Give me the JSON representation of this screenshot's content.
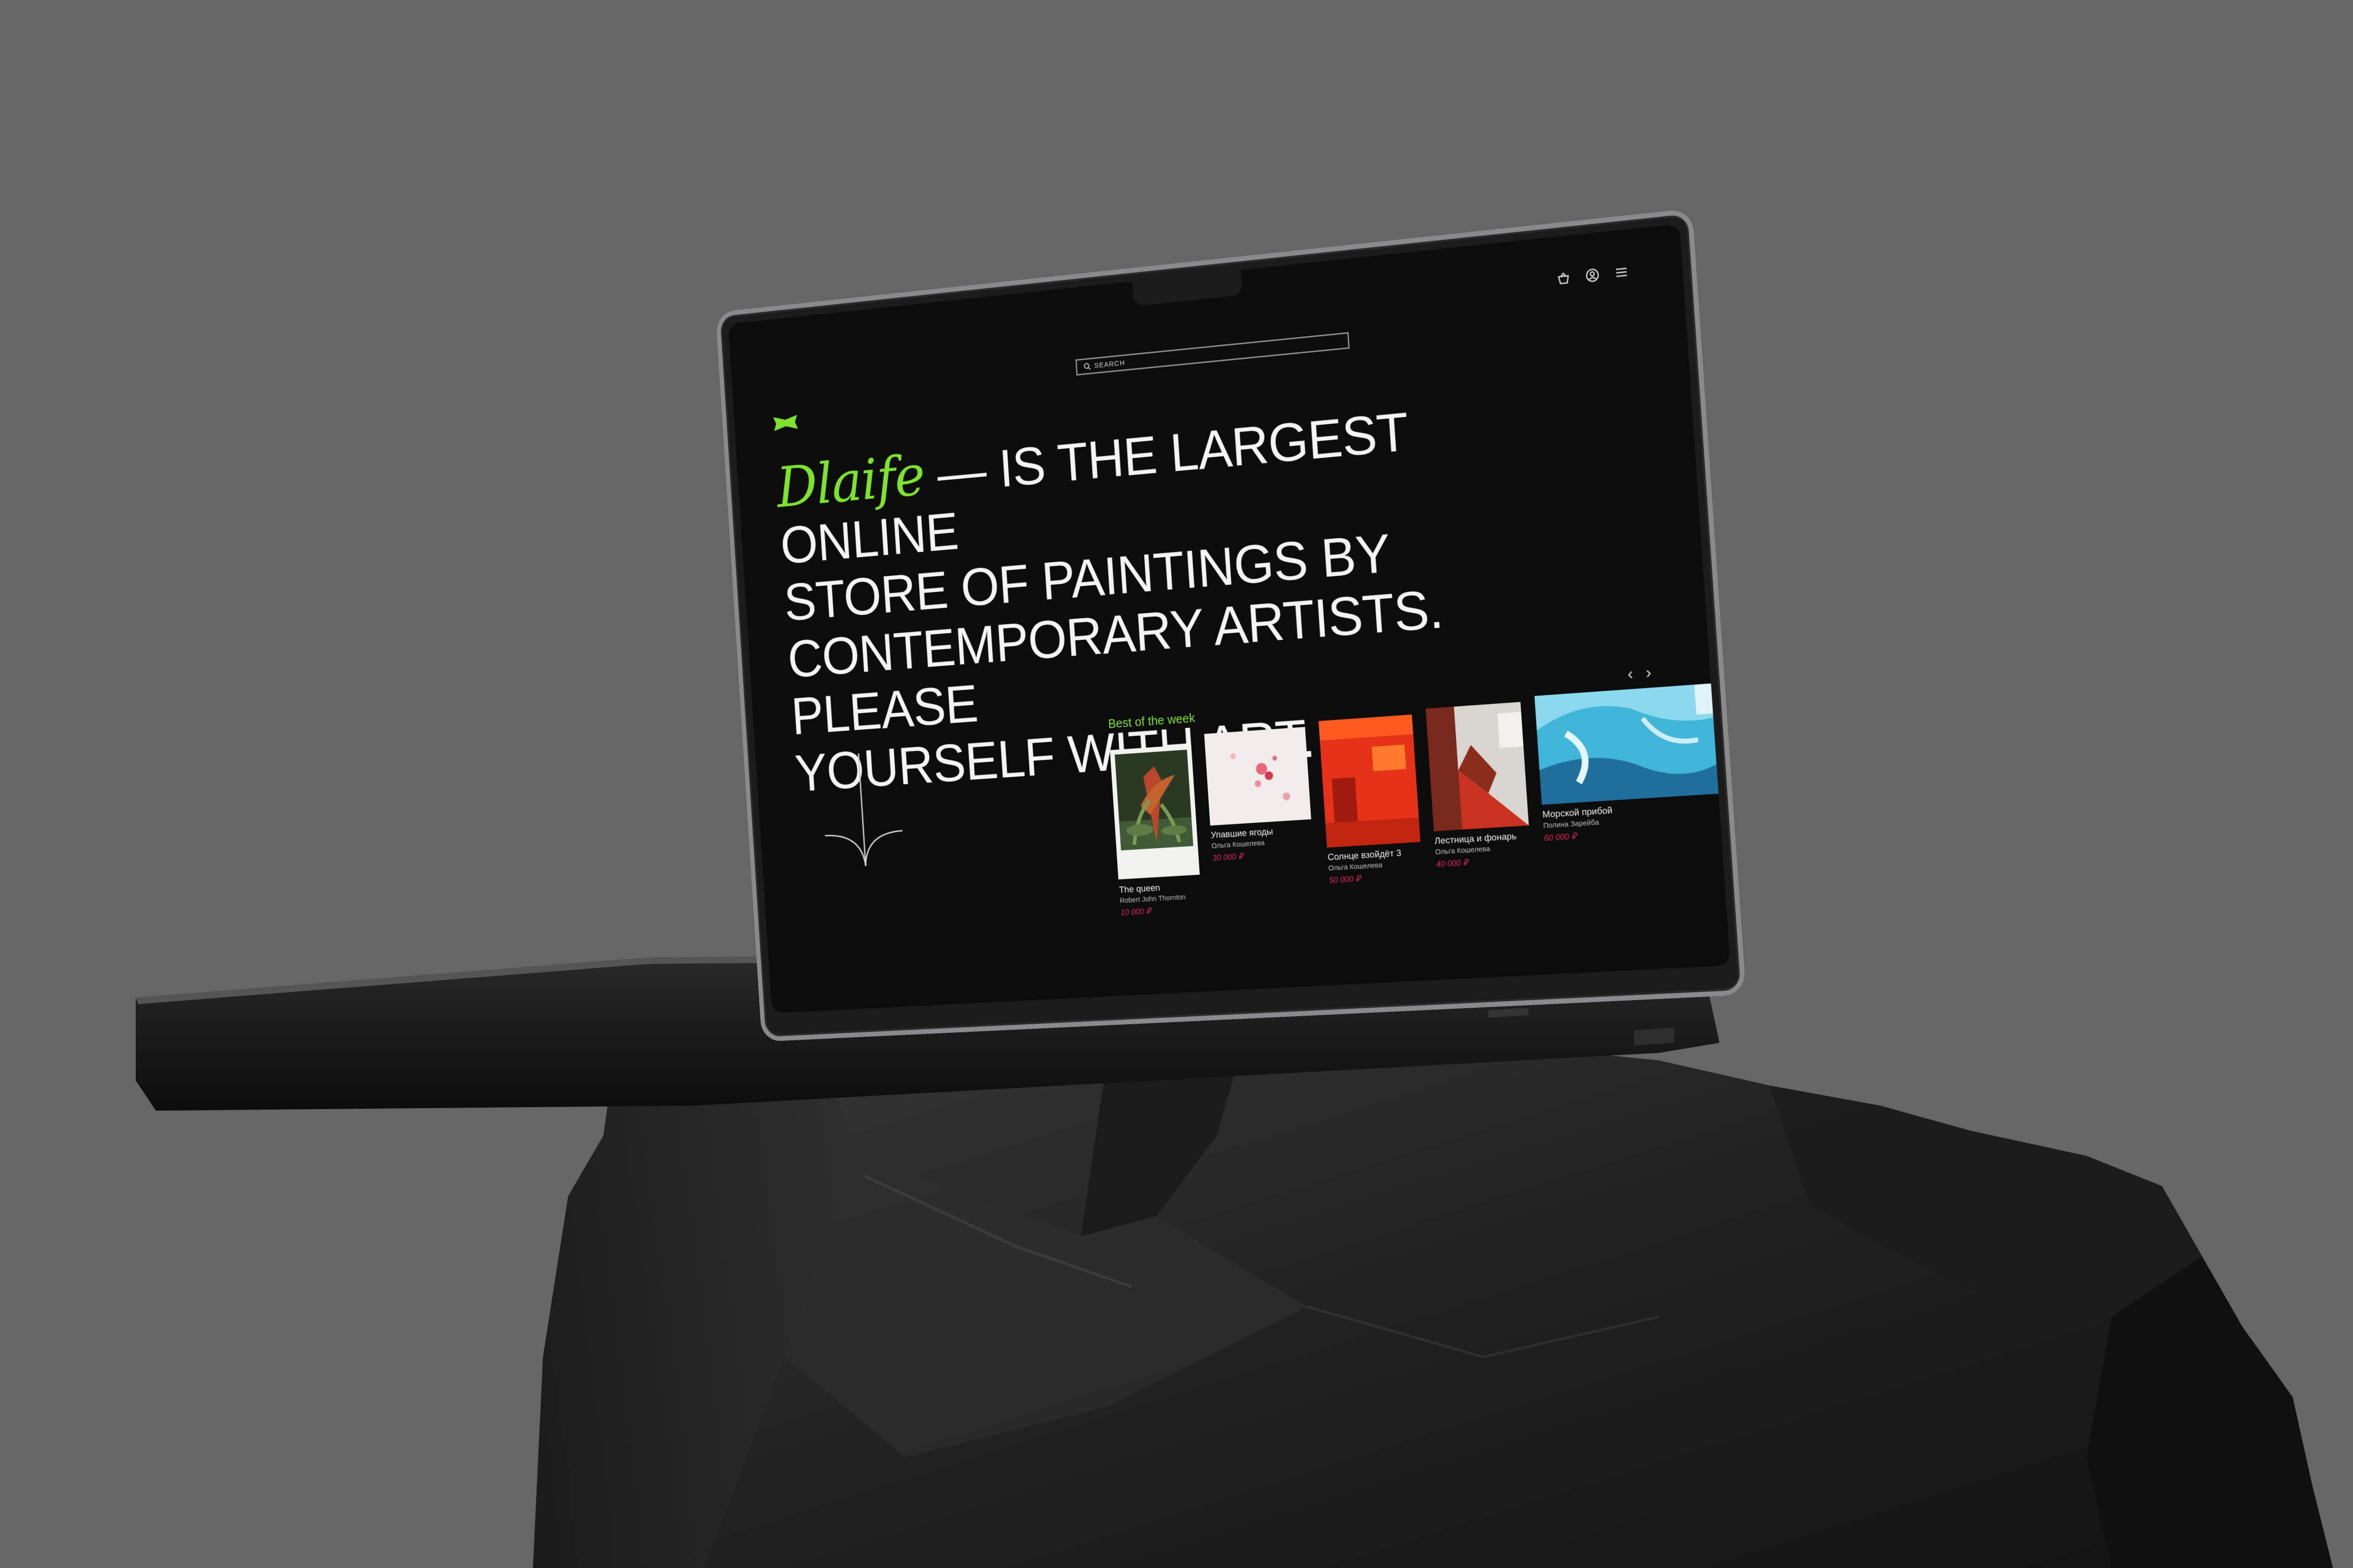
{
  "search": {
    "label": "SEARCH"
  },
  "header": {
    "icons": [
      "cart-icon",
      "user-icon",
      "menu-icon"
    ]
  },
  "hero": {
    "brand": "Dlaife",
    "line1": "— IS THE LARGEST ONLINE",
    "line2": "STORE OF PAINTINGS BY",
    "line3": "CONTEMPORARY ARTISTS. PLEASE",
    "line4": "YOURSELF WITH ART."
  },
  "best": {
    "title": "Best of the week",
    "prev": "‹",
    "next": "›",
    "items": [
      {
        "title": "The queen",
        "artist": "Robert John Thornton",
        "price": "10 000 ₽"
      },
      {
        "title": "Упавшие ягоды",
        "artist": "Ольга Кошелева",
        "price": "30 000 ₽"
      },
      {
        "title": "Солнце взойдёт 3",
        "artist": "Ольга Кошелева",
        "price": "50 000 ₽"
      },
      {
        "title": "Лестница и фонарь",
        "artist": "Ольга Кошелева",
        "price": "40 000 ₽"
      },
      {
        "title": "Морской прибой",
        "artist": "Полина Зарейба",
        "price": "60 000 ₽"
      }
    ]
  },
  "colors": {
    "accent": "#7ee32e",
    "price": "#e0245e",
    "background": "#666666"
  }
}
